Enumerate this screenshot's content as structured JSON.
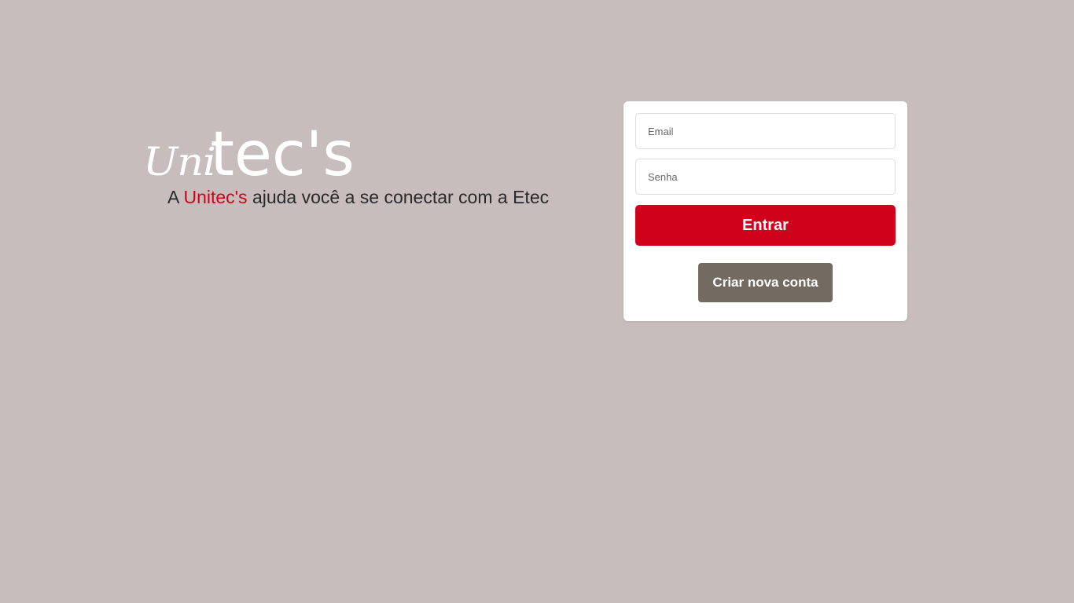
{
  "brand": {
    "logo_part1": "Uni",
    "logo_part2": "tec's",
    "tagline_prefix": "A ",
    "tagline_brand": "Unitec's",
    "tagline_suffix": " ajuda você a se conectar com a Etec"
  },
  "login": {
    "email_placeholder": "Email",
    "email_value": "",
    "password_placeholder": "Senha",
    "password_value": "",
    "submit_label": "Entrar",
    "create_account_label": "Criar nova conta"
  },
  "colors": {
    "background": "#c7bdbc",
    "accent": "#d0021b",
    "secondary_button": "#736a61",
    "card": "#ffffff"
  }
}
